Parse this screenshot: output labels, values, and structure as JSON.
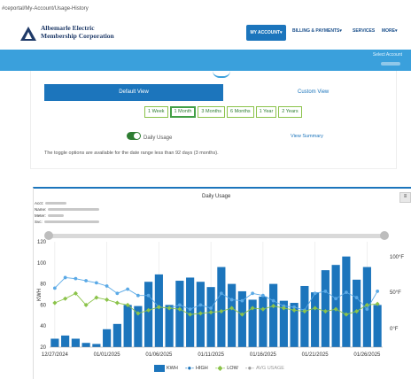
{
  "url": "#ceportal/My-Account/Usage-History",
  "org_name_line1": "Albemarle Electric",
  "org_name_line2": "Membership Corporation",
  "nav": {
    "my_account": "MY ACCOUNT▾",
    "billing": "BILLING & PAYMENTS▾",
    "services": "SERVICES",
    "more": "MORE▾"
  },
  "select_account": "Select Account",
  "view": {
    "default": "Default View",
    "custom": "Custom View"
  },
  "ranges": [
    "1 Week",
    "1 Month",
    "3 Months",
    "6 Months",
    "1 Year",
    "2 Years"
  ],
  "selected_range": "1 Month",
  "daily_usage_label": "Daily Usage",
  "view_summary": "View Summary",
  "toggle_note": "The toggle options are available for the date range less than 92 days (3 months).",
  "chart_title": "Daily Usage",
  "info": {
    "acct": "Acct:",
    "name": "Name:",
    "meter": "Meter:",
    "svc": "Svc:"
  },
  "colors": {
    "accent": "#1c75bc",
    "bluebar": "#3aa0dc",
    "high": "#1c75bc",
    "low": "#8bc34a",
    "avg": "#9e9e9e"
  },
  "chart_data": {
    "type": "bar",
    "title": "Daily Usage",
    "ylabel": "KWH",
    "y2label": "°F",
    "ylim": [
      20,
      120
    ],
    "yticks": [
      20,
      40,
      60,
      80,
      100,
      120
    ],
    "y2ticks": [
      "100°F",
      "50°F",
      "0°F"
    ],
    "xtick_labels": [
      "12/27/2024",
      "01/01/2025",
      "01/06/2025",
      "01/11/2025",
      "01/16/2025",
      "01/21/2025",
      "01/26/2025"
    ],
    "series": [
      {
        "name": "KWH",
        "values": [
          28,
          31,
          28,
          24,
          23,
          37,
          42,
          60,
          59,
          82,
          89,
          60,
          83,
          86,
          82,
          77,
          96,
          80,
          73,
          65,
          68,
          80,
          64,
          62,
          78,
          72,
          93,
          98,
          106,
          84,
          96,
          60
        ]
      },
      {
        "name": "HIGH",
        "values": [
          76,
          86,
          85,
          83,
          81,
          78,
          71,
          75,
          69,
          69,
          58,
          57,
          60,
          56,
          60,
          57,
          71,
          65,
          64,
          71,
          69,
          64,
          59,
          58,
          55,
          71,
          73,
          66,
          72,
          67,
          56,
          73
        ]
      },
      {
        "name": "LOW",
        "values": [
          62,
          66,
          71,
          60,
          67,
          65,
          62,
          60,
          52,
          55,
          58,
          57,
          56,
          51,
          52,
          53,
          54,
          57,
          51,
          57,
          56,
          59,
          57,
          55,
          54,
          57,
          54,
          56,
          51,
          54,
          60,
          61
        ]
      },
      {
        "name": "AVG USAGE",
        "values": []
      }
    ]
  }
}
